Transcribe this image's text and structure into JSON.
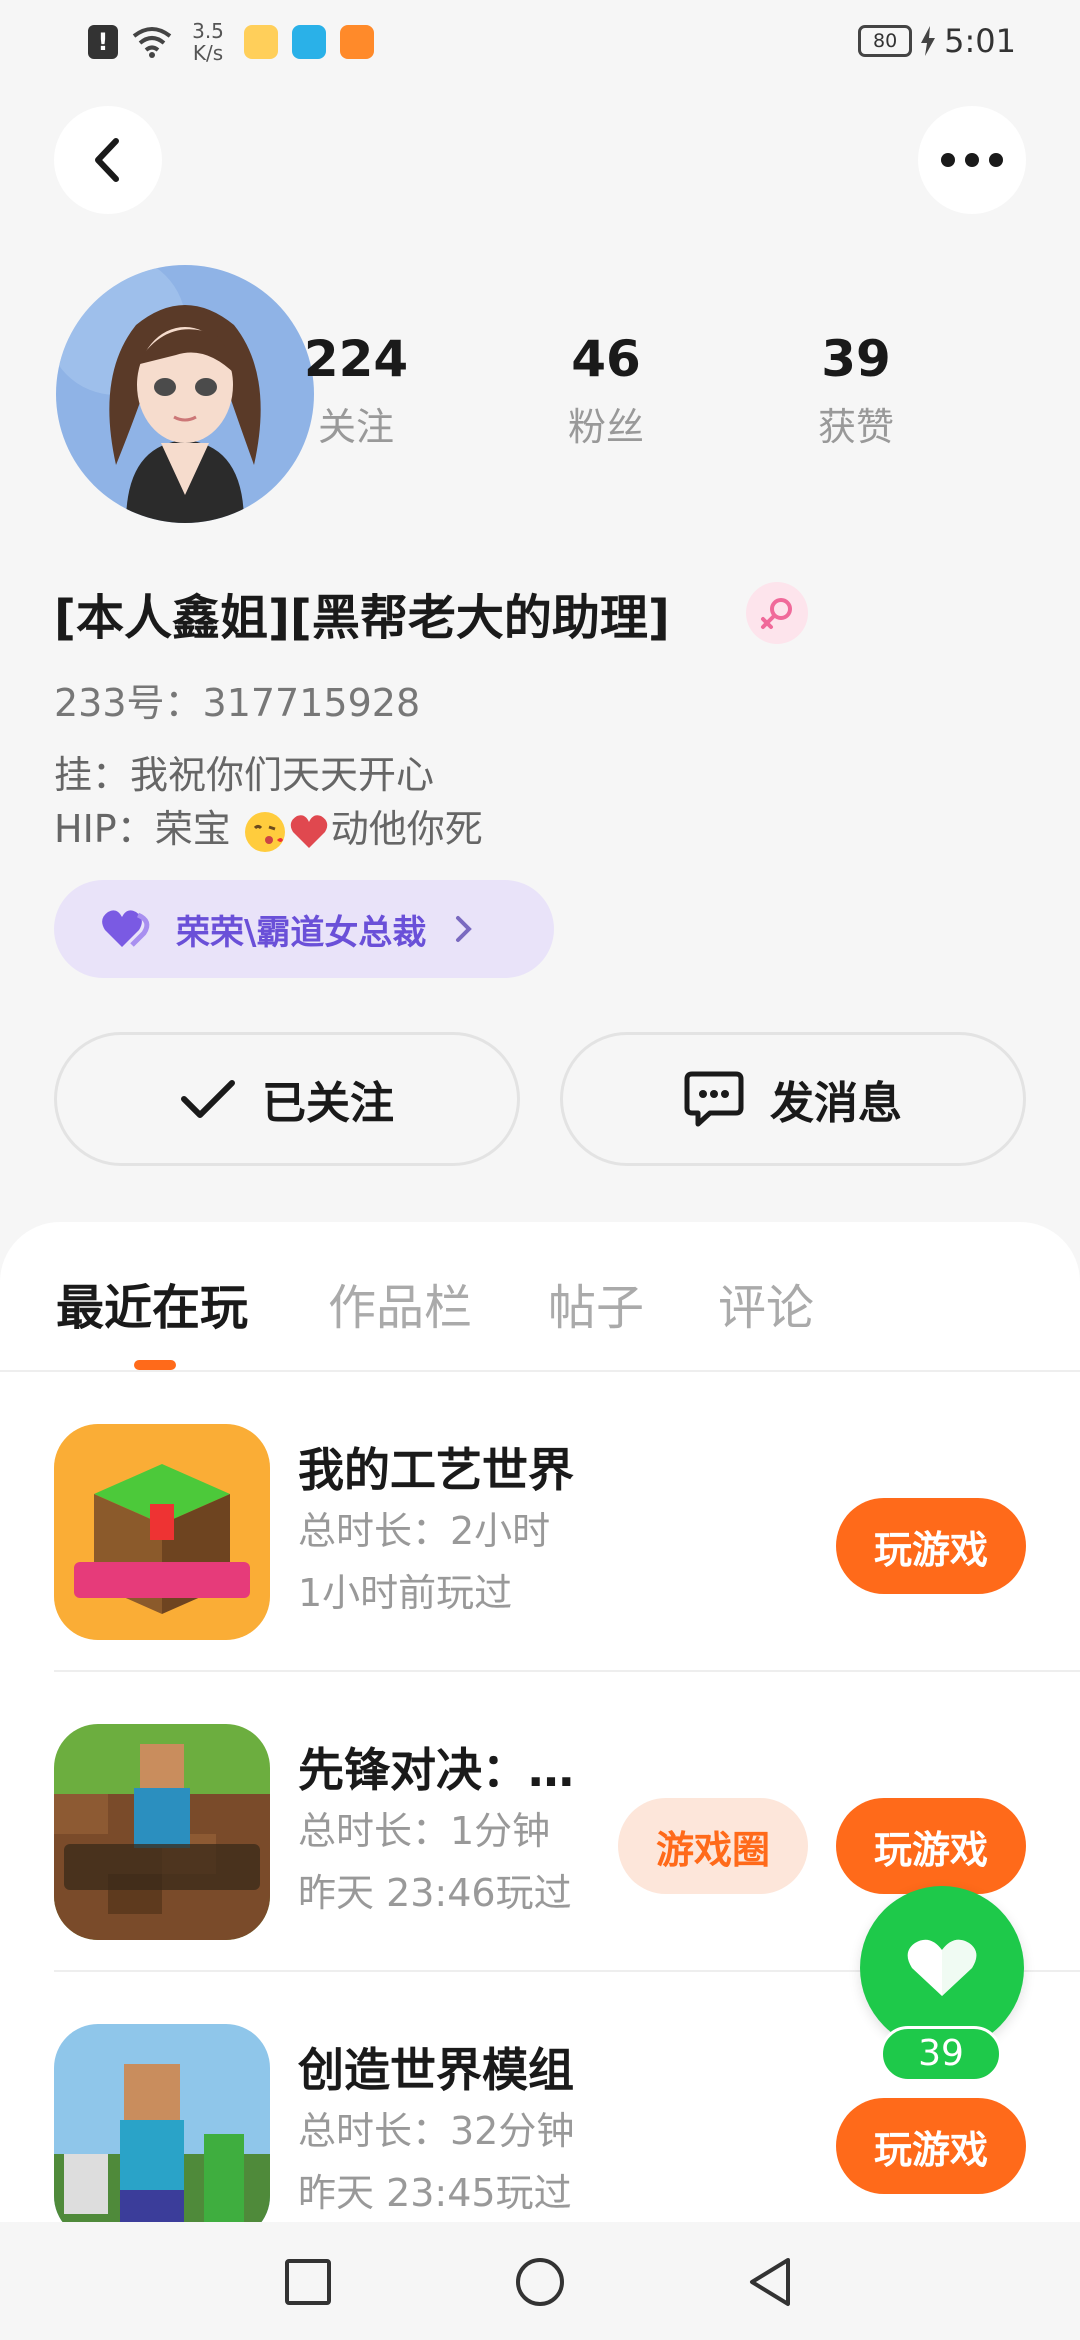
{
  "status_bar": {
    "alert": "!",
    "net_speed": "3.5 K/s",
    "battery": "80",
    "time": "5:01"
  },
  "profile": {
    "stats": [
      {
        "value": "224",
        "label": "关注"
      },
      {
        "value": "46",
        "label": "粉丝"
      },
      {
        "value": "39",
        "label": "获赞"
      }
    ],
    "nickname": "[本人鑫姐][黑帮老大的助理]",
    "uid": "233号：317715928",
    "bio_line1": "挂：我祝你们天天开心",
    "bio_line2_a": "HIP：荣宝",
    "bio_line2_b": "动他你死",
    "title_chip": "荣荣\\霸道女总裁"
  },
  "actions": {
    "follow_label": "已关注",
    "message_label": "发消息"
  },
  "tabs": [
    "最近在玩",
    "作品栏",
    "帖子",
    "评论"
  ],
  "games": [
    {
      "name": "我的工艺世界",
      "total": "总时长：2小时",
      "last": "1小时前玩过",
      "play": "玩游戏"
    },
    {
      "name": "先锋对决：…",
      "total": "总时长：1分钟",
      "last": "昨天 23:46玩过",
      "play": "玩游戏",
      "circle": "游戏圈"
    },
    {
      "name": "创造世界模组",
      "total": "总时长：32分钟",
      "last": "昨天 23:45玩过",
      "play": "玩游戏"
    }
  ],
  "like": {
    "count": "39"
  },
  "colors": {
    "accent": "#ff6a1a",
    "like_green": "#1ec94a",
    "chip_purple": "#6a50d8"
  }
}
